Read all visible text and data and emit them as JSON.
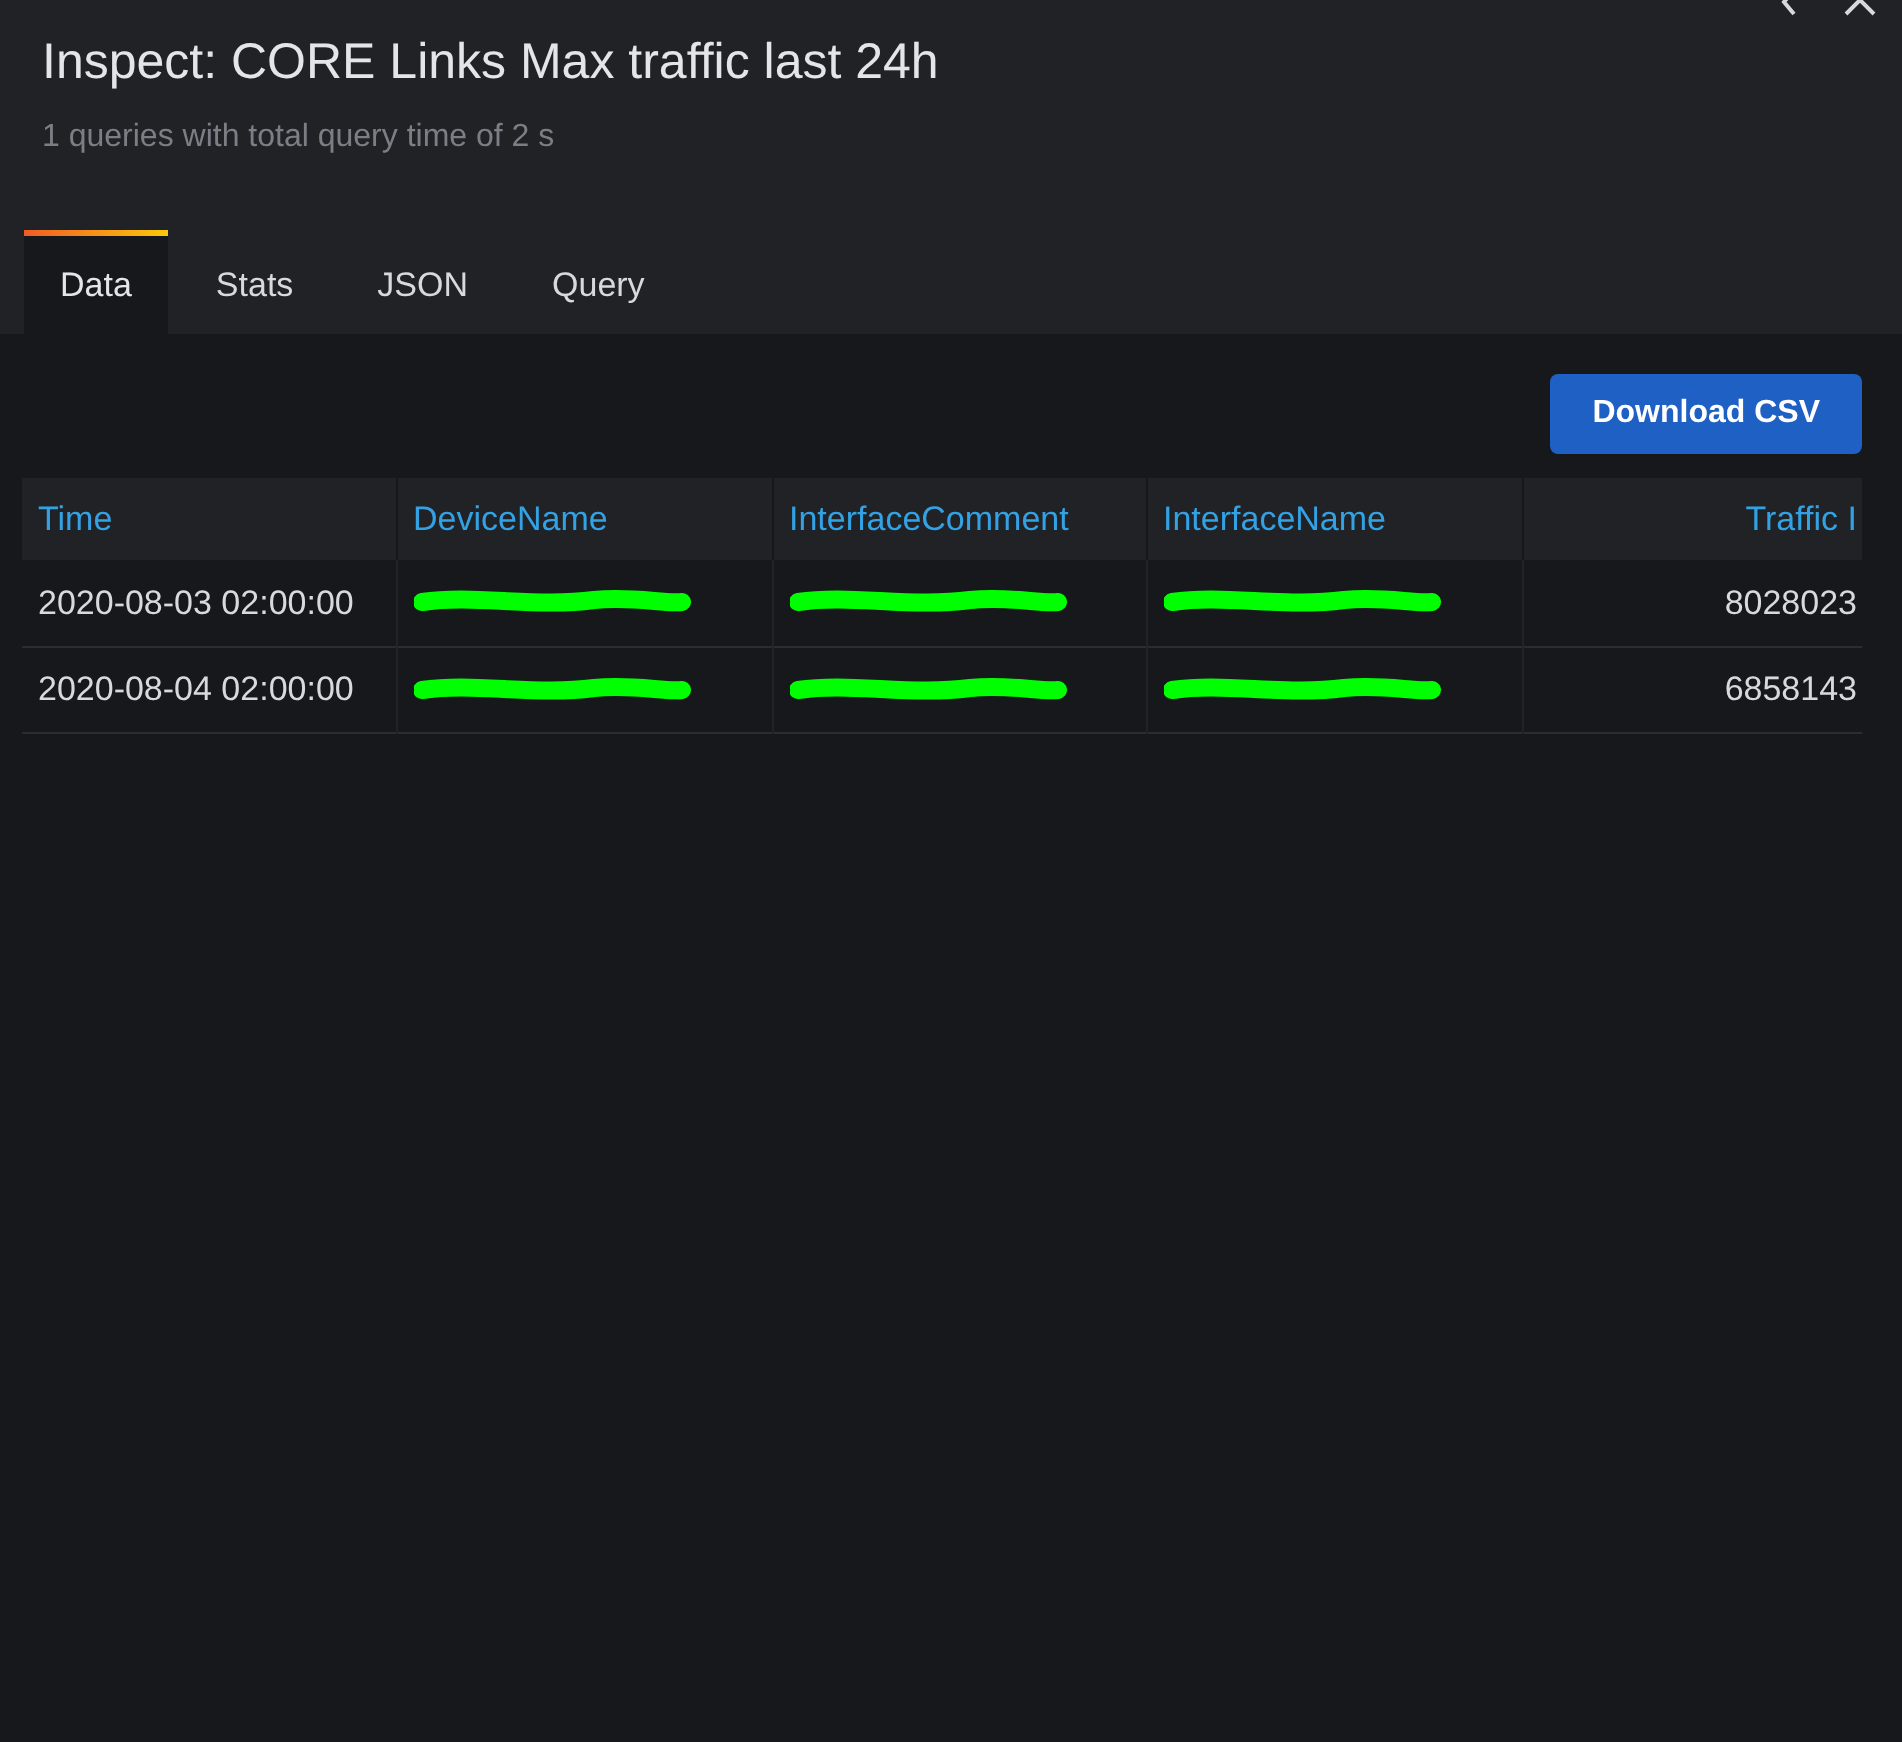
{
  "drawer": {
    "title": "Inspect: CORE Links Max traffic last 24h",
    "subtitle": "1 queries with total query time of 2 s"
  },
  "tabs": [
    {
      "label": "Data",
      "selected": true
    },
    {
      "label": "Stats",
      "selected": false
    },
    {
      "label": "JSON",
      "selected": false
    },
    {
      "label": "Query",
      "selected": false
    }
  ],
  "download_button": "Download CSV",
  "table": {
    "columns": [
      {
        "label": "Time"
      },
      {
        "label": "DeviceName"
      },
      {
        "label": "InterfaceComment"
      },
      {
        "label": "InterfaceName"
      },
      {
        "label": "Traffic I"
      }
    ],
    "rows": [
      [
        {
          "kind": "text",
          "text": "2020-08-03 02:00:00"
        },
        {
          "kind": "redacted"
        },
        {
          "kind": "redacted"
        },
        {
          "kind": "redacted"
        },
        {
          "kind": "text",
          "text": "8028023"
        }
      ],
      [
        {
          "kind": "text",
          "text": "2020-08-04 02:00:00"
        },
        {
          "kind": "redacted"
        },
        {
          "kind": "redacted"
        },
        {
          "kind": "redacted"
        },
        {
          "kind": "text",
          "text": "6858143"
        }
      ]
    ]
  }
}
